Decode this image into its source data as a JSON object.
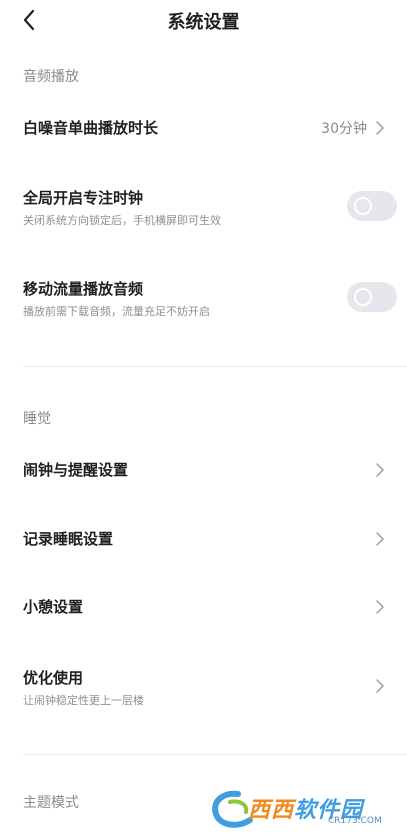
{
  "header": {
    "title": "系统设置"
  },
  "sections": {
    "audio": {
      "label": "音频播放",
      "items": [
        {
          "title": "白噪音单曲播放时长",
          "value": "30分钟"
        },
        {
          "title": "全局开启专注时钟",
          "subtitle": "关闭系统方向锁定后，手机横屏即可生效",
          "toggle": false
        },
        {
          "title": "移动流量播放音频",
          "subtitle": "播放前需下载音频，流量充足不妨开启",
          "toggle": false
        }
      ]
    },
    "sleep": {
      "label": "睡觉",
      "items": [
        {
          "title": "闹钟与提醒设置"
        },
        {
          "title": "记录睡眠设置"
        },
        {
          "title": "小憩设置"
        },
        {
          "title": "优化使用",
          "subtitle": "让闹钟稳定性更上一层楼"
        }
      ]
    },
    "theme": {
      "label": "主题模式"
    }
  },
  "watermark": {
    "brand_a": "西西",
    "brand_b": "软件园",
    "url": "CR173.COM"
  },
  "colors": {
    "text_primary": "#1f1f1f",
    "text_secondary": "#8a8a8a",
    "toggle_off": "#e6e7ec",
    "divider": "#ececec"
  }
}
